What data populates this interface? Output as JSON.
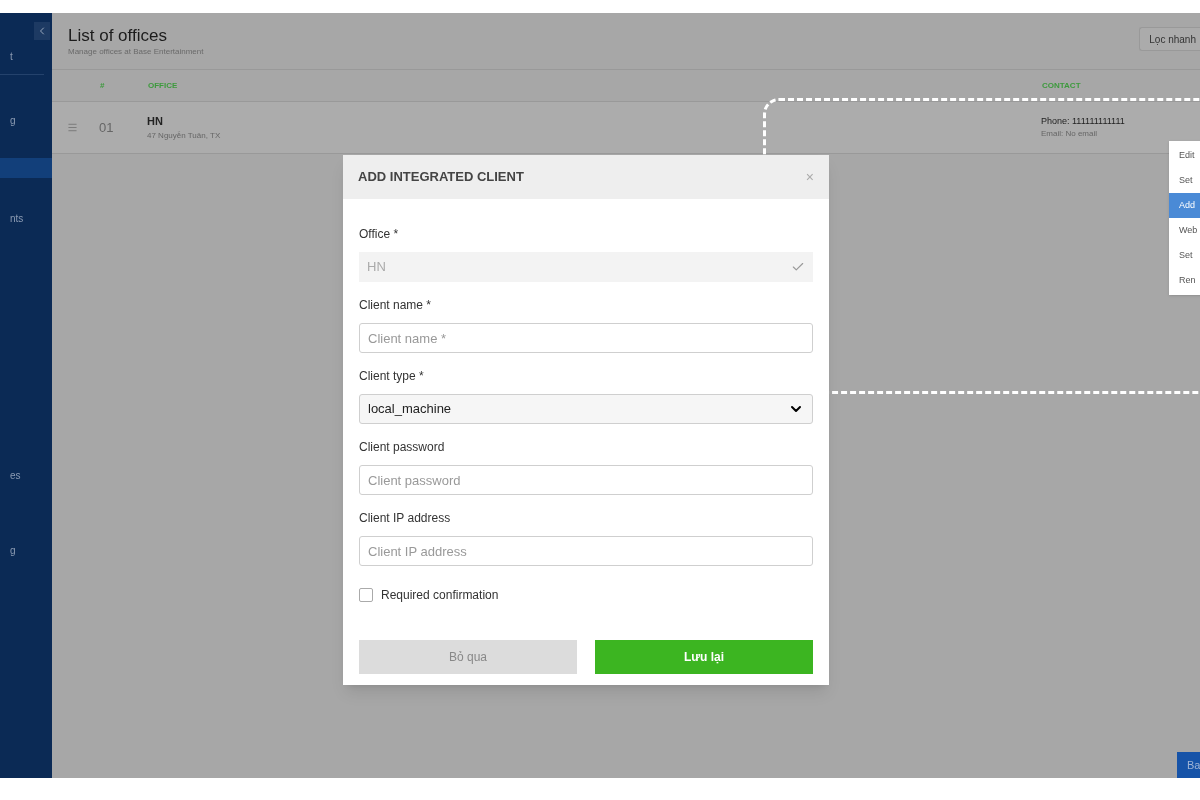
{
  "sidebar": {
    "items": [
      {
        "label": "t",
        "selected": false
      },
      {
        "label": "g",
        "selected": false
      },
      {
        "selected": true
      },
      {
        "label": "nts",
        "selected": false
      },
      {
        "label": "es",
        "selected": false
      },
      {
        "label": "g",
        "selected": false
      }
    ]
  },
  "header": {
    "title": "List of offices",
    "subtitle": "Manage offices at Base Entertainment",
    "filter_button": "Lọc nhanh"
  },
  "table": {
    "columns": [
      "#",
      "OFFICE",
      "CONTACT"
    ],
    "rows": [
      {
        "index": "01",
        "office": "HN",
        "address": "47 Nguyễn Tuân, TX",
        "phone": "Phone: 111111111111",
        "email": "Email: No email"
      }
    ]
  },
  "context_menu": [
    {
      "label": "Edit",
      "selected": false
    },
    {
      "label": "Set",
      "selected": false
    },
    {
      "label": "Add",
      "selected": true
    },
    {
      "label": "Web",
      "selected": false
    },
    {
      "label": "Set",
      "selected": false
    },
    {
      "label": "Ren",
      "selected": false
    }
  ],
  "corner_button": "Ba",
  "dialog": {
    "title": "ADD INTEGRATED CLIENT",
    "close": "×",
    "fields": [
      {
        "kind": "readonly",
        "label": "Office *",
        "value": "HN"
      },
      {
        "kind": "text",
        "label": "Client name *",
        "placeholder": "Client name *"
      },
      {
        "kind": "select",
        "label": "Client type *",
        "value": "local_machine"
      },
      {
        "kind": "text",
        "label": "Client password",
        "placeholder": "Client password"
      },
      {
        "kind": "text",
        "label": "Client IP address",
        "placeholder": "Client IP address"
      }
    ],
    "checkbox": {
      "label": "Required confirmation",
      "checked": false
    },
    "buttons": [
      {
        "label": "Bỏ qua",
        "kind": "secondary"
      },
      {
        "label": "Lưu lại",
        "kind": "primary"
      }
    ]
  }
}
